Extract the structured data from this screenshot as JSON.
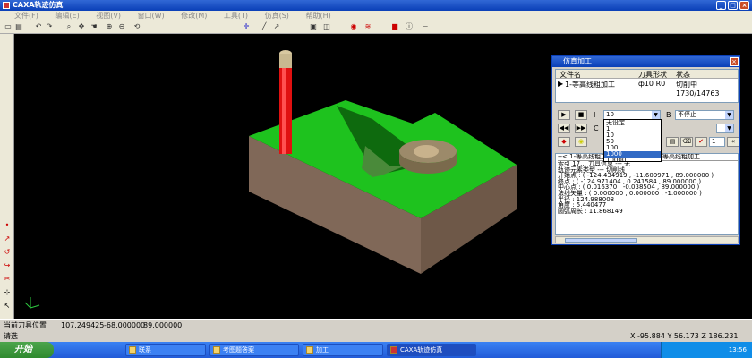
{
  "window": {
    "title": "CAXA轨迹仿真"
  },
  "menu": [
    "文件(F)",
    "编辑(E)",
    "视图(V)",
    "窗口(W)",
    "修改(M)",
    "工具(T)",
    "仿真(S)",
    "帮助(H)"
  ],
  "status": {
    "label": "当前刀具位置",
    "x": "107.249425",
    "y": "-68.000000",
    "z": "89.000000"
  },
  "hint": {
    "left": "请选",
    "coords": "X  -95.884 Y   56.173 Z   186.231"
  },
  "taskbar": {
    "start": "开始",
    "tasks": [
      "联系",
      "考图题答案",
      "加工",
      "CAXA轨迹仿真"
    ],
    "time": "13:56"
  },
  "dialog": {
    "title": "仿真加工",
    "columns": [
      "文件名",
      "刀具形状",
      "状态"
    ],
    "row": {
      "name": "1-等高线粗加工",
      "tool": "ф10 R0",
      "status": "切削中 1730/14763"
    },
    "i_label": "I",
    "i_value": "10",
    "b_label": "B",
    "b_value": "不停止",
    "c_label": "C",
    "spin_value": "1",
    "dropdown": [
      "无设定",
      "1",
      "10",
      "50",
      "100",
      "1000",
      "10000"
    ],
    "info": [
      "--< 1-等高线粗加工 >--",
      "1-等高线粗加工",
      "索引  17...  刀具信息 --- 无",
      "轨迹元素类型  ---  切削线",
      "开始点  : ( -124.434919 , -11.609971 , 89.000000 )",
      "终点   : ( -124.971404 , 0.241584 , 89.000000 )",
      "中心点  : ( 0.016370 , -0.038504 , 89.000000 )",
      "法线矢量 : ( 0.000000 , 0.000000 , -1.000000 )",
      "半径   : 124.988008",
      "角度   : 5.440477",
      "圆弧周长 : 11.868149"
    ]
  },
  "colors": {
    "block_top": "#1ec21e",
    "block_side": "#806858",
    "tool": "#e01010",
    "tool_tip": "#d8c8a0"
  }
}
